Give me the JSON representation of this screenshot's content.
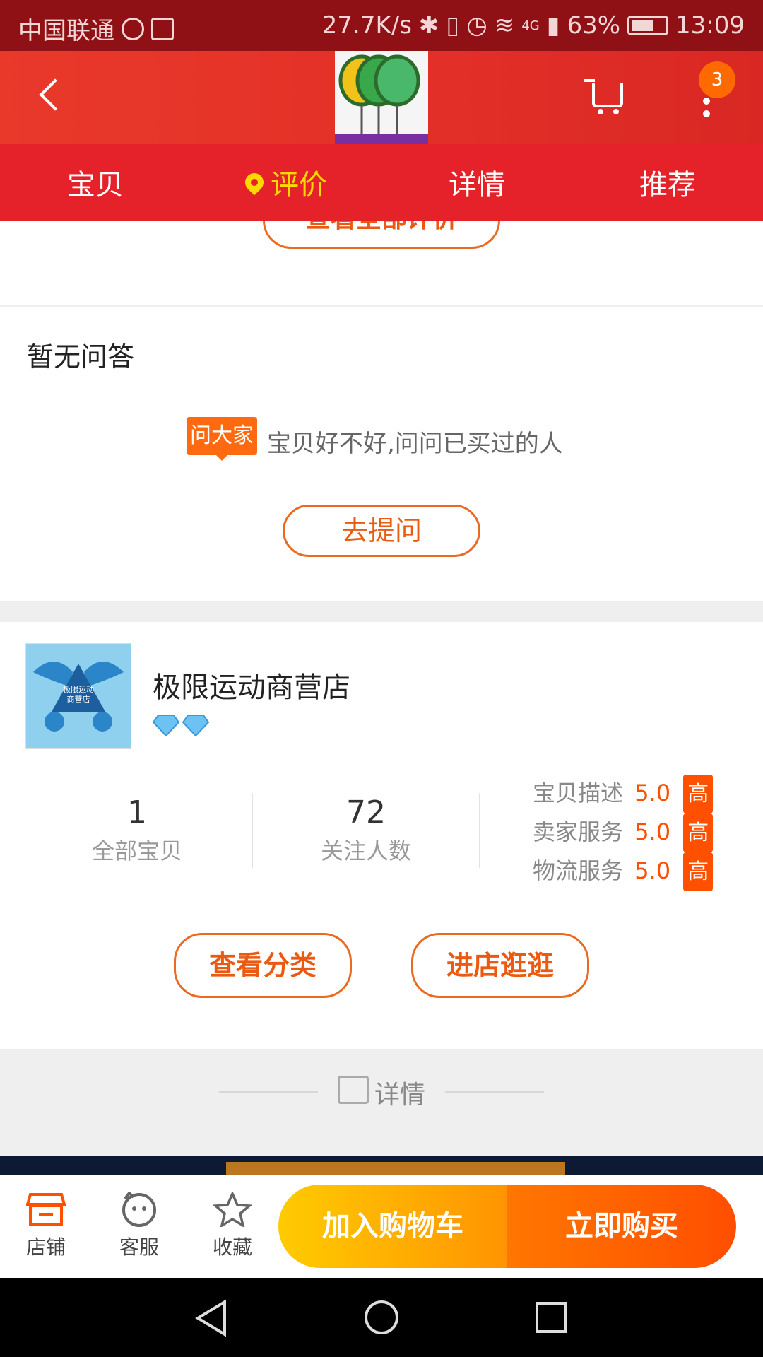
{
  "status_bar": {
    "carrier": "中国联通",
    "network_speed": "27.7K/s",
    "signal_type": "4G",
    "battery": "63%",
    "time": "13:09"
  },
  "header": {
    "cart_badge": "3",
    "icons": [
      "back-arrow-icon",
      "cart-icon",
      "more-vertical-icon"
    ]
  },
  "tabs": {
    "items": [
      {
        "label": "宝贝"
      },
      {
        "label": "评价",
        "active": true
      },
      {
        "label": "详情"
      },
      {
        "label": "推荐"
      }
    ]
  },
  "reviews": {
    "view_all_label": "查看全部评价"
  },
  "qa": {
    "empty_title": "暂无问答",
    "ask_tag": "问大家",
    "ask_prompt": "宝贝好不好,问问已买过的人",
    "ask_button": "去提问"
  },
  "shop": {
    "logo_text": "极限运动\n商营店",
    "name": "极限运动商营店",
    "stats": [
      {
        "value": "1",
        "label": "全部宝贝"
      },
      {
        "value": "72",
        "label": "关注人数"
      }
    ],
    "ratings": [
      {
        "label": "宝贝描述",
        "score": "5.0",
        "level": "高"
      },
      {
        "label": "卖家服务",
        "score": "5.0",
        "level": "高"
      },
      {
        "label": "物流服务",
        "score": "5.0",
        "level": "高"
      }
    ],
    "category_button": "查看分类",
    "enter_button": "进店逛逛"
  },
  "details_divider": {
    "label": "详情"
  },
  "bottom_bar": {
    "shop_label": "店铺",
    "service_label": "客服",
    "favorite_label": "收藏",
    "add_cart_label": "加入购物车",
    "buy_now_label": "立即购买"
  },
  "colors": {
    "brand_red": "#e5222a",
    "accent_orange": "#ff5000",
    "tab_active": "#ffd800"
  }
}
